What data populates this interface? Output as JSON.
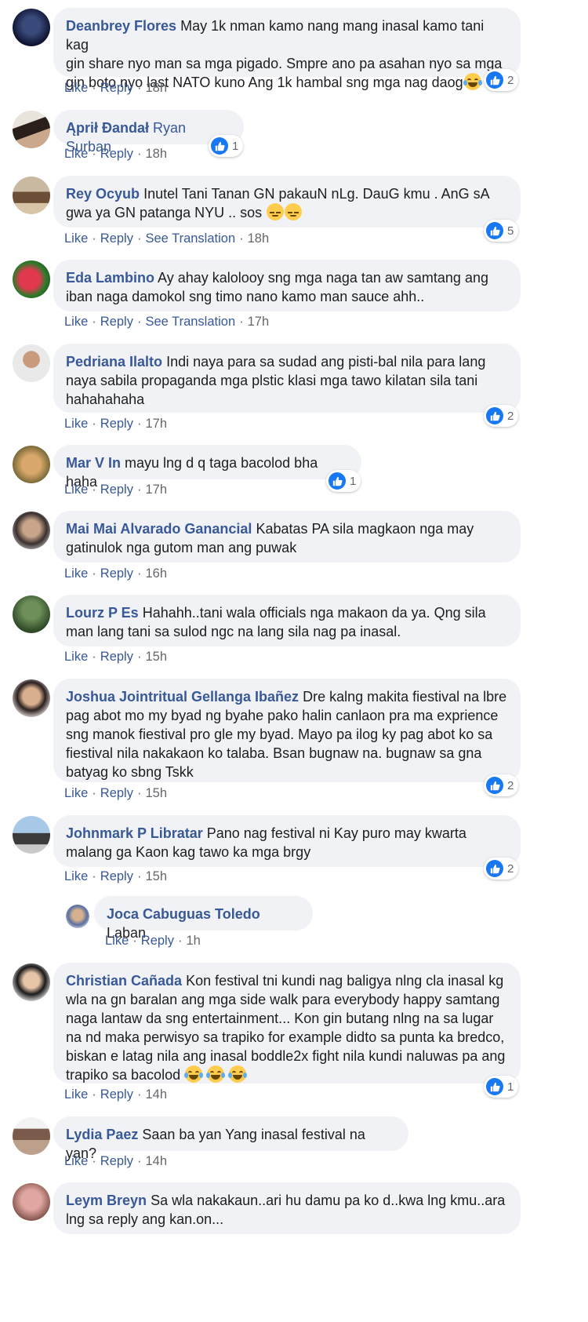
{
  "actions": {
    "like": "Like",
    "reply": "Reply",
    "see_translation": "See Translation",
    "separator": "·"
  },
  "colors": {
    "author": "#385898",
    "bubble": "#f0f2f5",
    "like_badge": "#1877f2"
  },
  "comments": [
    {
      "author": "Deanbrey Flores",
      "lines": [
        "May 1k nman kamo nang mang inasal kamo tani kag",
        "gin share nyo man sa mga pigado. Smpre ano pa asahan nyo sa mga",
        "gin boto nyo last NATO kuno Ang 1k hambal sng mga nag daog"
      ],
      "emoji": "face-with-tears-of-joy",
      "time": "18h",
      "likes": "2"
    },
    {
      "author": "Ąprił Đandał",
      "lines": [
        "Ryan Surban"
      ],
      "time": "18h",
      "likes": "1"
    },
    {
      "author": "Rey Ocyub",
      "lines": [
        "Inutel Tani Tanan GN pakauN nLg. DauG kmu . AnG sA",
        "gwa ya GN patanga NYU .. sos"
      ],
      "emoji": "unamused-face x2",
      "time": "18h",
      "likes": "5",
      "translate": true
    },
    {
      "author": "Eda Lambino",
      "lines": [
        "Ay ahay kalolooy sng mga naga tan aw samtang ang",
        "iban naga damokol sng timo nano kamo man sauce ahh.."
      ],
      "time": "17h",
      "translate": true
    },
    {
      "author": "Pedriana Ilalto",
      "lines": [
        "Indi naya para sa sudad ang pisti-bal nila para lang",
        "naya sabila propaganda mga plstic klasi mga tawo kilatan sila tani",
        "hahahahaha"
      ],
      "time": "17h",
      "likes": "2"
    },
    {
      "author": "Mar V In",
      "lines": [
        "mayu lng d q taga bacolod bha haha"
      ],
      "time": "17h",
      "likes": "1"
    },
    {
      "author": "Mai Mai Alvarado Ganancial",
      "lines": [
        "Kabatas PA sila magkaon nga may",
        "gatinulok nga gutom man ang puwak"
      ],
      "time": "16h"
    },
    {
      "author": "Lourz P Es",
      "lines": [
        "Hahahh..tani wala officials nga makaon da ya. Qng sila",
        "man lang tani sa sulod ngc na lang sila nag pa inasal."
      ],
      "time": "15h"
    },
    {
      "author": "Joshua Jointritual Gellanga Ibañez",
      "lines": [
        "Dre kalng makita fiestival na lbre",
        "pag abot mo my byad ng byahe pako halin canlaon pra ma exprience",
        "sng manok fiestival pro gle my byad. Mayo pa ilog ky pag abot ko sa",
        "fiestival nila nakakaon ko talaba. Bsan bugnaw na. bugnaw sa gna",
        "batyag ko sbng Tskk"
      ],
      "time": "15h",
      "likes": "2"
    },
    {
      "author": "Johnmark P Libratar",
      "lines": [
        "Pano nag festival ni Kay puro may kwarta",
        "malang ga Kaon kag tawo ka mga brgy"
      ],
      "time": "15h",
      "likes": "2"
    },
    {
      "author": "Joca Cabuguas Toledo",
      "lines": [
        "Laban"
      ],
      "time": "1h",
      "reply": true
    },
    {
      "author": "Christian Cañada",
      "lines": [
        "Kon festival tni kundi nag baligya nlng cla inasal kg",
        "wla na gn baralan ang mga side walk para everybody happy samtang",
        "naga lantaw da sng entertainment... Kon gin butang nlng na sa lugar",
        "na nd maka perwisyo sa trapiko for example didto sa punta ka bredco,",
        "biskan e latag nila ang inasal boddle2x fight nila kundi naluwas pa ang",
        "trapiko sa bacolod"
      ],
      "emoji": "face-with-tears-of-joy x3",
      "time": "14h",
      "likes": "1"
    },
    {
      "author": "Lydia Paez",
      "lines": [
        "Saan ba yan Yang inasal festival na yan?"
      ],
      "time": "14h"
    },
    {
      "author": "Leym Breyn",
      "lines": [
        "Sa wla nakakaun..ari hu damu pa ko d..kwa lng kmu..ara",
        "lng sa reply ang kan.on..."
      ]
    }
  ]
}
